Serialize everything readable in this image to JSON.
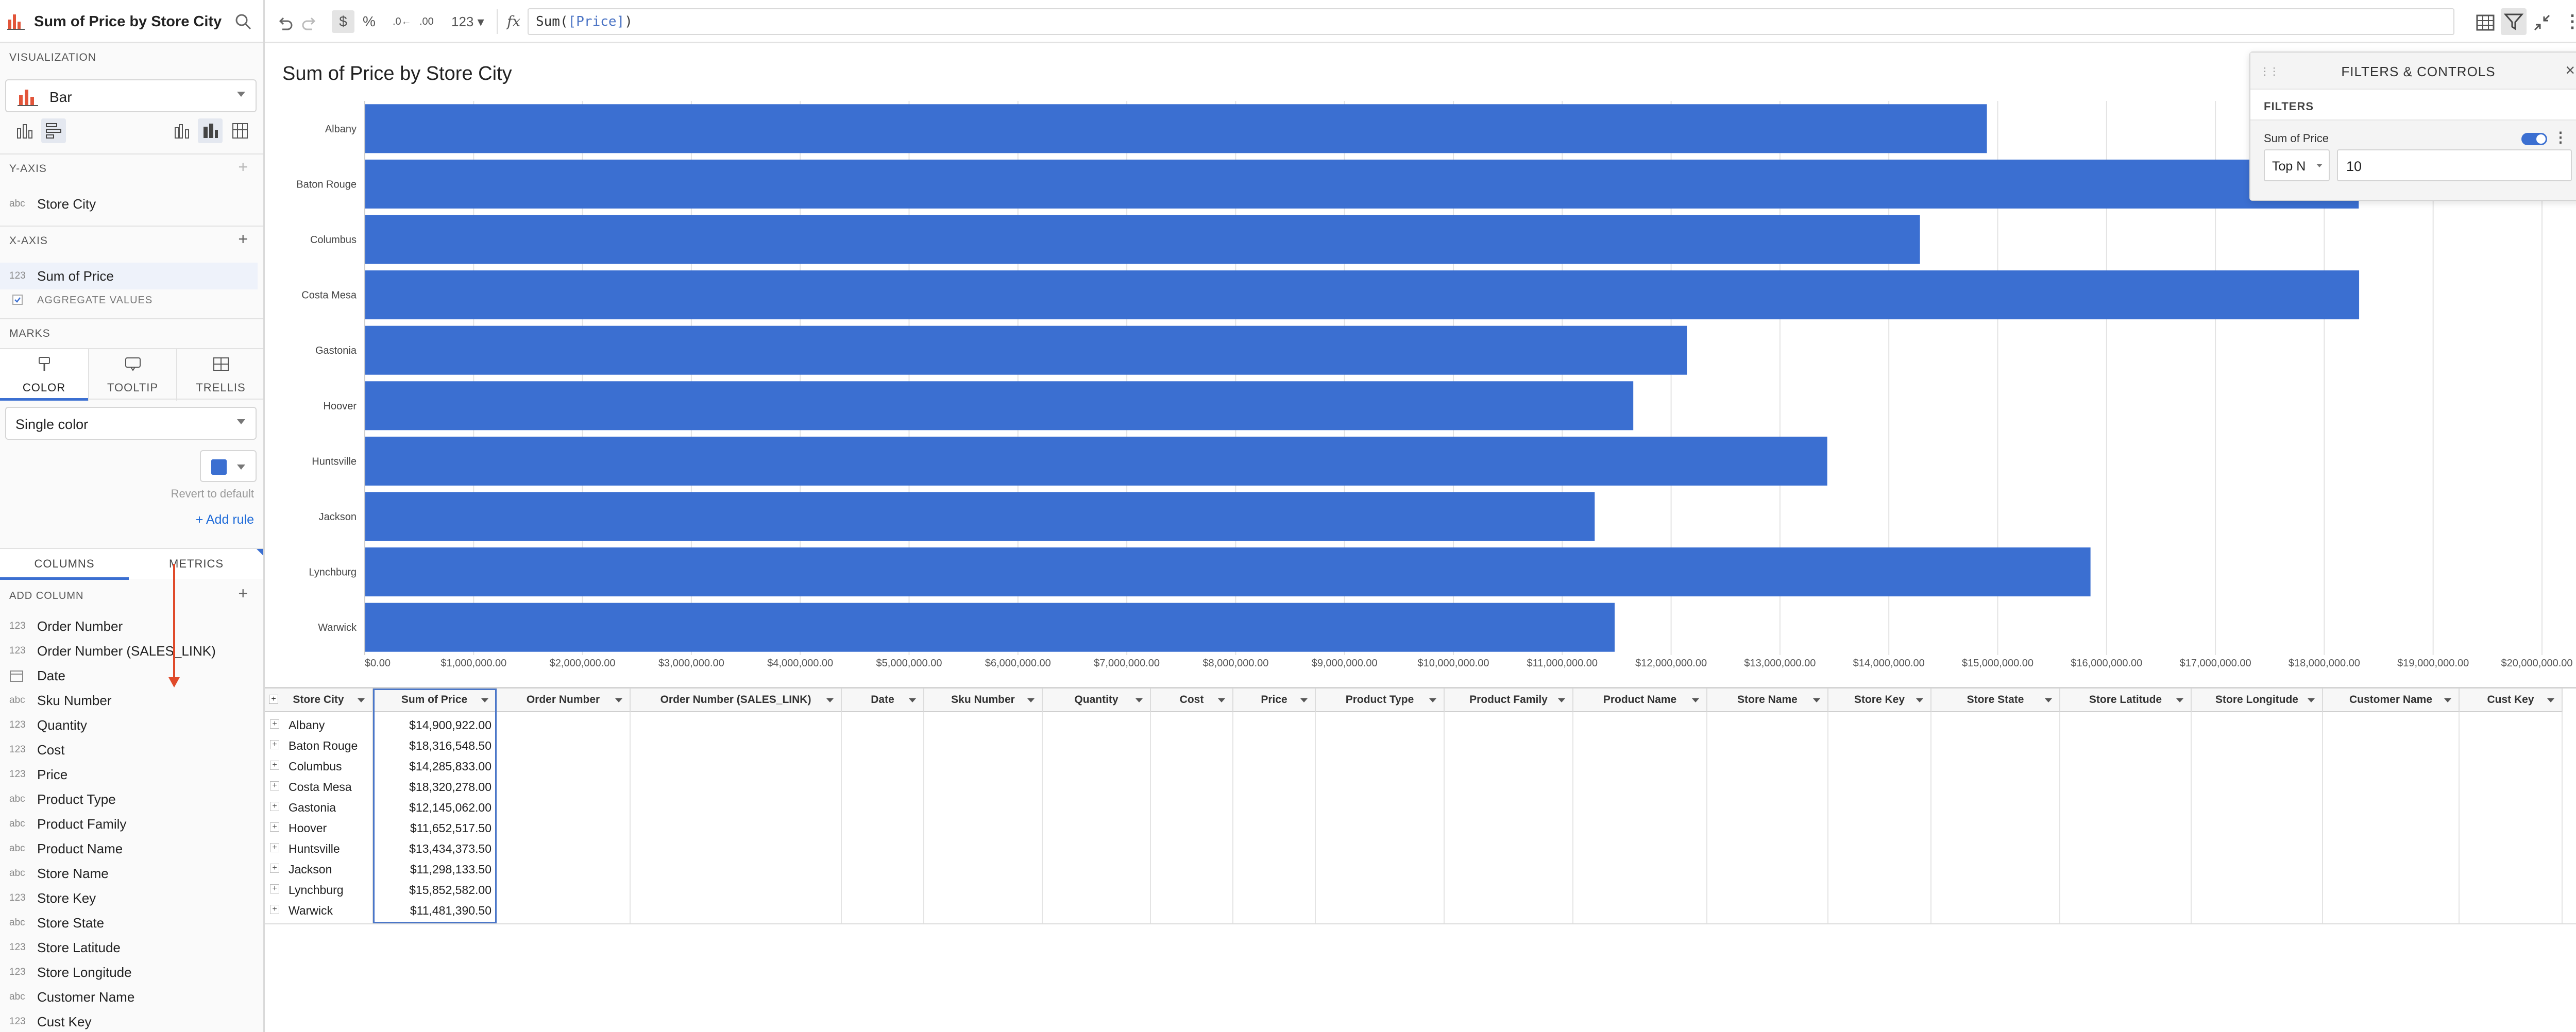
{
  "sidebar": {
    "title": "Sum of Price by Store City",
    "visualization_label": "VISUALIZATION",
    "visualization_type": "Bar",
    "y_axis_label": "Y-AXIS",
    "y_axis_field": {
      "type": "abc",
      "name": "Store City"
    },
    "x_axis_label": "X-AXIS",
    "x_axis_field": {
      "type": "123",
      "name": "Sum of Price"
    },
    "aggregate_label": "AGGREGATE VALUES",
    "marks_label": "MARKS",
    "marks_tabs": [
      "COLOR",
      "TOOLTIP",
      "TRELLIS"
    ],
    "color_mode": "Single color",
    "color_value": "#3b6fd1",
    "revert_label": "Revert to default",
    "add_rule_label": "+ Add rule",
    "tabs": [
      "COLUMNS",
      "METRICS"
    ],
    "add_column_label": "ADD COLUMN",
    "columns": [
      {
        "type": "123",
        "name": "Order Number"
      },
      {
        "type": "123",
        "name": "Order Number (SALES_LINK)"
      },
      {
        "type": "date",
        "name": "Date"
      },
      {
        "type": "abc",
        "name": "Sku Number"
      },
      {
        "type": "123",
        "name": "Quantity"
      },
      {
        "type": "123",
        "name": "Cost"
      },
      {
        "type": "123",
        "name": "Price"
      },
      {
        "type": "abc",
        "name": "Product Type"
      },
      {
        "type": "abc",
        "name": "Product Family"
      },
      {
        "type": "abc",
        "name": "Product Name"
      },
      {
        "type": "abc",
        "name": "Store Name"
      },
      {
        "type": "123",
        "name": "Store Key"
      },
      {
        "type": "abc",
        "name": "Store State"
      },
      {
        "type": "123",
        "name": "Store Latitude"
      },
      {
        "type": "123",
        "name": "Store Longitude"
      },
      {
        "type": "abc",
        "name": "Customer Name"
      },
      {
        "type": "123",
        "name": "Cust Key"
      }
    ]
  },
  "toolbar": {
    "currency": "$",
    "percent": "%",
    "number_format": "123",
    "fx": "fx",
    "formula_prefix": "Sum(",
    "formula_ref": "[Price]",
    "formula_suffix": ")"
  },
  "chart_title": "Sum of Price by Store City",
  "chart_data": {
    "type": "bar",
    "orientation": "horizontal",
    "categories": [
      "Albany",
      "Baton Rouge",
      "Columbus",
      "Costa Mesa",
      "Gastonia",
      "Hoover",
      "Huntsville",
      "Jackson",
      "Lynchburg",
      "Warwick"
    ],
    "values": [
      14900922.0,
      18316548.5,
      14285833.0,
      18320278.0,
      12145062.0,
      11652517.5,
      13434373.5,
      11298133.5,
      15852582.0,
      11481390.5
    ],
    "xlim": [
      0,
      20000000
    ],
    "x_ticks": [
      "$0.00",
      "$1,000,000.00",
      "$2,000,000.00",
      "$3,000,000.00",
      "$4,000,000.00",
      "$5,000,000.00",
      "$6,000,000.00",
      "$7,000,000.00",
      "$8,000,000.00",
      "$9,000,000.00",
      "$10,000,000.00",
      "$11,000,000.00",
      "$12,000,000.00",
      "$13,000,000.00",
      "$14,000,000.00",
      "$15,000,000.00",
      "$16,000,000.00",
      "$17,000,000.00",
      "$18,000,000.00",
      "$19,000,000.00",
      "$20,000,000.00"
    ],
    "grid": true,
    "bar_color": "#3b6fd1"
  },
  "filters": {
    "title": "FILTERS & CONTROLS",
    "section": "FILTERS",
    "filter_name": "Sum of Price",
    "mode": "Top N",
    "value": "10",
    "enabled": true
  },
  "table": {
    "columns": [
      "Store City",
      "Sum of Price",
      "Order Number",
      "Order Number (SALES_LINK)",
      "Date",
      "Sku Number",
      "Quantity",
      "Cost",
      "Price",
      "Product Type",
      "Product Family",
      "Product Name",
      "Store Name",
      "Store Key",
      "Store State",
      "Store Latitude",
      "Store Longitude",
      "Customer Name",
      "Cust Key"
    ],
    "rows": [
      {
        "city": "Albany",
        "sum": "$14,900,922.00"
      },
      {
        "city": "Baton Rouge",
        "sum": "$18,316,548.50"
      },
      {
        "city": "Columbus",
        "sum": "$14,285,833.00"
      },
      {
        "city": "Costa Mesa",
        "sum": "$18,320,278.00"
      },
      {
        "city": "Gastonia",
        "sum": "$12,145,062.00"
      },
      {
        "city": "Hoover",
        "sum": "$11,652,517.50"
      },
      {
        "city": "Huntsville",
        "sum": "$13,434,373.50"
      },
      {
        "city": "Jackson",
        "sum": "$11,298,133.50"
      },
      {
        "city": "Lynchburg",
        "sum": "$15,852,582.00"
      },
      {
        "city": "Warwick",
        "sum": "$11,481,390.50"
      }
    ]
  }
}
